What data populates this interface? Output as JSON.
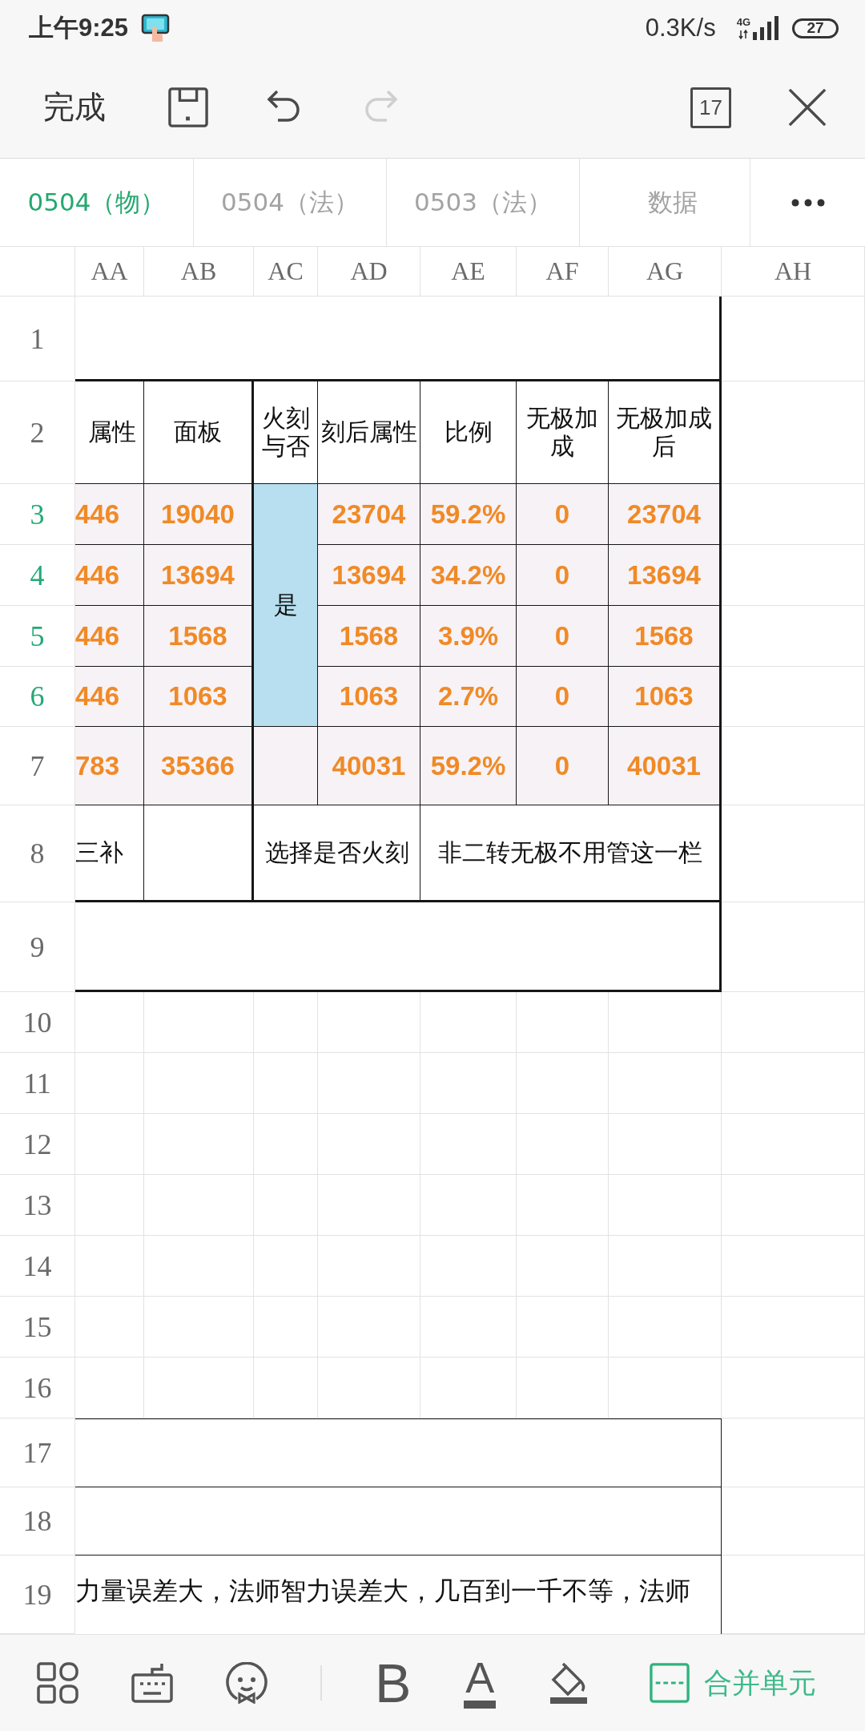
{
  "status_bar": {
    "time": "上午9:25",
    "net_speed": "0.3K/s",
    "network": "4G",
    "battery": "27"
  },
  "toolbar": {
    "done": "完成",
    "actions": [
      {
        "kind": "save",
        "disabled": false
      },
      {
        "kind": "undo",
        "disabled": false
      },
      {
        "kind": "redo",
        "disabled": true
      }
    ],
    "count": "17"
  },
  "sheet_tabs": [
    {
      "label": "0504（物）",
      "selected": true
    },
    {
      "label": "0504（法）",
      "selected": false
    },
    {
      "label": "0503（法）",
      "selected": false
    },
    {
      "label": "数据",
      "selected": false
    }
  ],
  "sheet": {
    "columns": [
      "AA",
      "AB",
      "AC",
      "AD",
      "AE",
      "AF",
      "AG",
      "AH"
    ],
    "rows": [
      {
        "number": "1",
        "selected": false
      },
      {
        "number": "2",
        "selected": false
      },
      {
        "number": "3",
        "selected": true
      },
      {
        "number": "4",
        "selected": true
      },
      {
        "number": "5",
        "selected": true
      },
      {
        "number": "6",
        "selected": true
      },
      {
        "number": "7",
        "selected": false
      },
      {
        "number": "8",
        "selected": false
      },
      {
        "number": "9",
        "selected": false
      },
      {
        "number": "10",
        "selected": false
      },
      {
        "number": "11",
        "selected": false
      },
      {
        "number": "12",
        "selected": false
      },
      {
        "number": "13",
        "selected": false
      },
      {
        "number": "14",
        "selected": false
      },
      {
        "number": "15",
        "selected": false
      },
      {
        "number": "16",
        "selected": false
      },
      {
        "number": "17",
        "selected": false
      },
      {
        "number": "18",
        "selected": false
      },
      {
        "number": "19",
        "selected": false
      }
    ],
    "table": {
      "header": [
        "属性",
        "面板",
        "火刻与否",
        "刻后属性",
        "比例",
        "无极加成",
        "无极加成后"
      ],
      "data_rows": [
        {
          "kind": "item",
          "cells": [
            "446",
            "19040",
            "23704",
            "59.2%",
            "0",
            "23704"
          ]
        },
        {
          "kind": "item",
          "cells": [
            "446",
            "13694",
            "13694",
            "34.2%",
            "0",
            "13694"
          ]
        },
        {
          "kind": "item",
          "cells": [
            "446",
            "1568",
            "1568",
            "3.9%",
            "0",
            "1568"
          ]
        },
        {
          "kind": "item",
          "cells": [
            "446",
            "1063",
            "1063",
            "2.7%",
            "0",
            "1063"
          ]
        },
        {
          "kind": "total",
          "cells": [
            "783",
            "35366",
            "40031",
            "59.2%",
            "0",
            "40031"
          ]
        }
      ],
      "fire_carved": "是",
      "notes": [
        "三补",
        "选择是否火刻",
        "非二转无极不用管这一栏"
      ]
    },
    "footer_note": "力量误差大，法师智力误差大，几百到一千不等，法师"
  },
  "bottom_toolbar": {
    "bold": "B",
    "font_color": "A",
    "merge": "合并单元"
  }
}
